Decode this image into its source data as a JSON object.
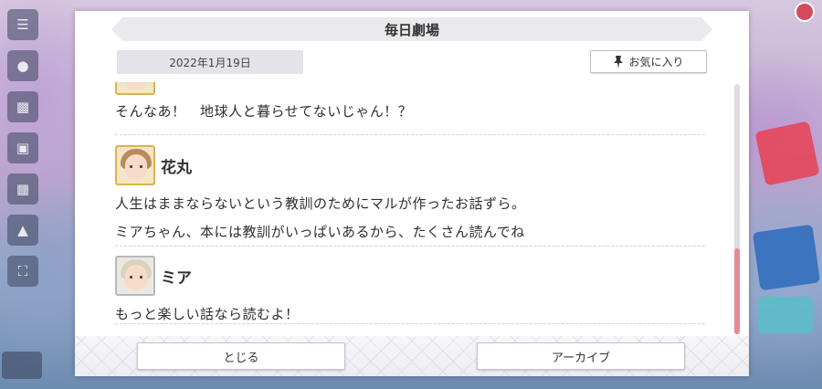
{
  "modal": {
    "title": "毎日劇場",
    "date": "2022年1月19日",
    "favorite_label": "お気に入り",
    "close_label": "とじる",
    "archive_label": "アーカイブ"
  },
  "messages": [
    {
      "speaker": "",
      "avatar_icon": "character-avatar-icon",
      "lines": [
        "そんなあ！　地球人と暮らせてないじゃん！？"
      ]
    },
    {
      "speaker": "花丸",
      "avatar_icon": "hanamaru-avatar-icon",
      "lines": [
        "人生はままならないという教訓のためにマルが作ったお話ずら。",
        "ミアちゃん、本には教訓がいっぱいあるから、たくさん読んでね"
      ]
    },
    {
      "speaker": "ミア",
      "avatar_icon": "mia-avatar-icon",
      "lines": [
        "もっと楽しい話なら読むよ！"
      ]
    }
  ],
  "colors": {
    "scroll_thumb": "#e38a93",
    "avatar_border_gold": "#d9b44a",
    "avatar_border_gray": "#b8b8c0"
  }
}
